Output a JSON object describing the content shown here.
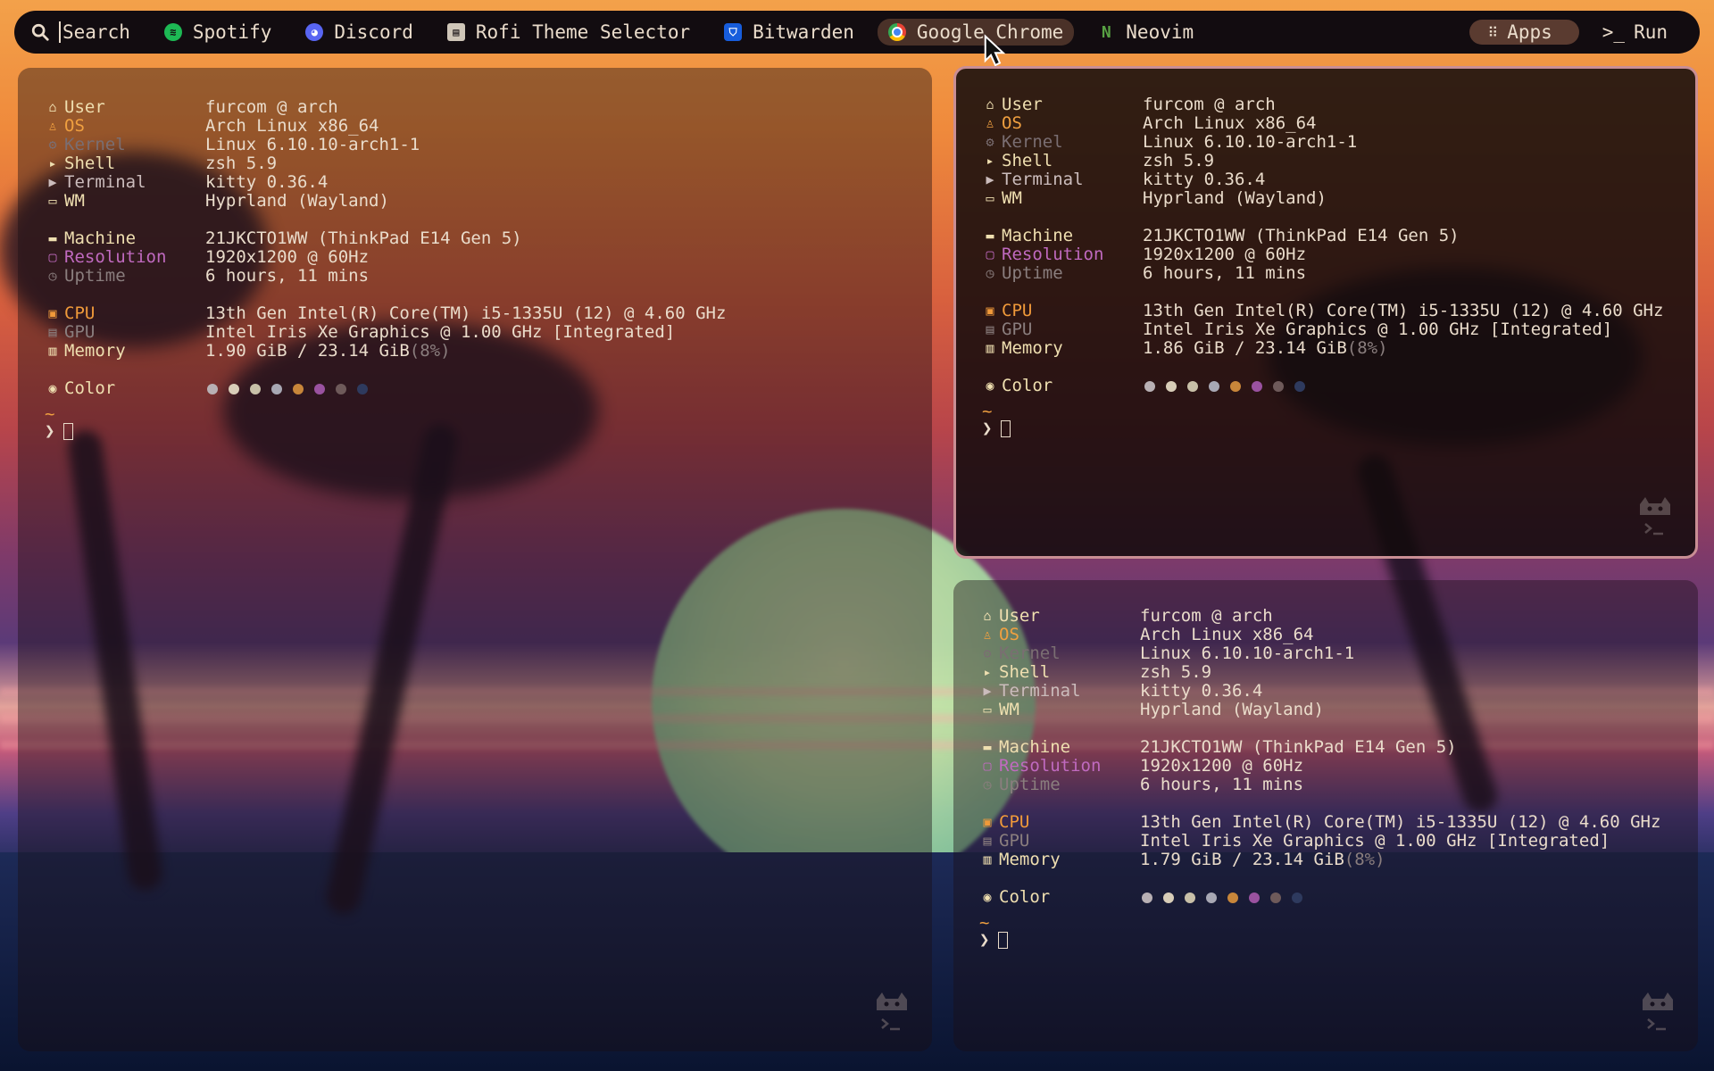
{
  "topbar": {
    "search_placeholder": "Search",
    "apps": [
      {
        "label": "Spotify",
        "icon": "spotify-icon",
        "color": "#1db954"
      },
      {
        "label": "Discord",
        "icon": "discord-icon",
        "color": "#5865f2"
      },
      {
        "label": "Rofi Theme Selector",
        "icon": "rofi-icon",
        "color": "#cfc6b8"
      },
      {
        "label": "Bitwarden",
        "icon": "bitwarden-icon",
        "color": "#175ddc"
      },
      {
        "label": "Google Chrome",
        "icon": "chrome-icon",
        "color": "#e94335",
        "active": true
      },
      {
        "label": "Neovim",
        "icon": "neovim-icon",
        "color": "#57a143"
      }
    ],
    "apps_button": "Apps",
    "run_button": "Run"
  },
  "terminals": [
    {
      "user": "furcom @ arch",
      "os": "Arch Linux x86_64",
      "kernel": "Linux 6.10.10-arch1-1",
      "shell": "zsh 5.9",
      "terminal": "kitty 0.36.4",
      "wm": "Hyprland (Wayland)",
      "machine": "21JKCTO1WW (ThinkPad E14 Gen 5)",
      "resolution": "1920x1200 @ 60Hz",
      "uptime": "6 hours, 11 mins",
      "cpu": "13th Gen Intel(R) Core(TM) i5-1335U (12) @ 4.60 GHz",
      "gpu": "Intel Iris Xe Graphics @ 1.00 GHz [Integrated]",
      "memory": "1.90 GiB / 23.14 GiB",
      "memory_pct": "(8%)"
    },
    {
      "user": "furcom @ arch",
      "os": "Arch Linux x86_64",
      "kernel": "Linux 6.10.10-arch1-1",
      "shell": "zsh 5.9",
      "terminal": "kitty 0.36.4",
      "wm": "Hyprland (Wayland)",
      "machine": "21JKCTO1WW (ThinkPad E14 Gen 5)",
      "resolution": "1920x1200 @ 60Hz",
      "uptime": "6 hours, 11 mins",
      "cpu": "13th Gen Intel(R) Core(TM) i5-1335U (12) @ 4.60 GHz",
      "gpu": "Intel Iris Xe Graphics @ 1.00 GHz [Integrated]",
      "memory": "1.86 GiB / 23.14 GiB",
      "memory_pct": "(8%)"
    },
    {
      "user": "furcom @ arch",
      "os": "Arch Linux x86_64",
      "kernel": "Linux 6.10.10-arch1-1",
      "shell": "zsh 5.9",
      "terminal": "kitty 0.36.4",
      "wm": "Hyprland (Wayland)",
      "machine": "21JKCTO1WW (ThinkPad E14 Gen 5)",
      "resolution": "1920x1200 @ 60Hz",
      "uptime": "6 hours, 11 mins",
      "cpu": "13th Gen Intel(R) Core(TM) i5-1335U (12) @ 4.60 GHz",
      "gpu": "Intel Iris Xe Graphics @ 1.00 GHz [Integrated]",
      "memory": "1.79 GiB / 23.14 GiB",
      "memory_pct": "(8%)"
    }
  ],
  "labels": {
    "user": "User",
    "os": "OS",
    "kernel": "Kernel",
    "shell": "Shell",
    "terminal": "Terminal",
    "wm": "WM",
    "machine": "Machine",
    "resolution": "Resolution",
    "uptime": "Uptime",
    "cpu": "CPU",
    "gpu": "GPU",
    "memory": "Memory",
    "color": "Color"
  },
  "prompt": {
    "tilde": "~",
    "symbol": "❯"
  },
  "palette": [
    "#b8b0b4",
    "#d8cdb8",
    "#c8c0a8",
    "#a8a8b4",
    "#c8863a",
    "#9a52a0",
    "#6e5a5a",
    "#2e3a5e"
  ]
}
